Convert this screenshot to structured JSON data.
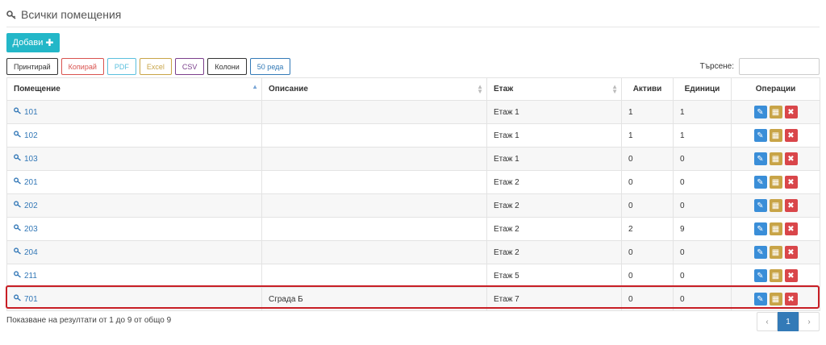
{
  "header": {
    "title": "Всички помещения",
    "icon": "key-icon"
  },
  "toolbar": {
    "add_label": "Добави",
    "add_icon": "plus-icon"
  },
  "export_buttons": [
    {
      "label": "Принтирай",
      "color": "#333333"
    },
    {
      "label": "Копирай",
      "color": "#d9534f"
    },
    {
      "label": "PDF",
      "color": "#5bc0de"
    },
    {
      "label": "Excel",
      "color": "#c8a447"
    },
    {
      "label": "CSV",
      "color": "#7b3f8c"
    },
    {
      "label": "Колони",
      "color": "#333333"
    },
    {
      "label": "50 реда",
      "color": "#337ab7"
    }
  ],
  "search": {
    "label": "Търсене:",
    "value": ""
  },
  "table": {
    "columns": [
      "Помещение",
      "Описание",
      "Етаж",
      "Активи",
      "Единици",
      "Операции"
    ],
    "rows": [
      {
        "room": "101",
        "description": "",
        "floor": "Етаж 1",
        "assets": "1",
        "units": "1"
      },
      {
        "room": "102",
        "description": "",
        "floor": "Етаж 1",
        "assets": "1",
        "units": "1"
      },
      {
        "room": "103",
        "description": "",
        "floor": "Етаж 1",
        "assets": "0",
        "units": "0"
      },
      {
        "room": "201",
        "description": "",
        "floor": "Етаж 2",
        "assets": "0",
        "units": "0"
      },
      {
        "room": "202",
        "description": "",
        "floor": "Етаж 2",
        "assets": "0",
        "units": "0"
      },
      {
        "room": "203",
        "description": "",
        "floor": "Етаж 2",
        "assets": "2",
        "units": "9"
      },
      {
        "room": "204",
        "description": "",
        "floor": "Етаж 2",
        "assets": "0",
        "units": "0"
      },
      {
        "room": "211",
        "description": "",
        "floor": "Етаж 5",
        "assets": "0",
        "units": "0"
      },
      {
        "room": "701",
        "description": "Сграда Б",
        "floor": "Етаж 7",
        "assets": "0",
        "units": "0"
      }
    ],
    "highlighted_row_index": 8
  },
  "footer": {
    "info": "Показване на резултати от 1 до 9 от общо 9"
  },
  "pager": {
    "prev": "‹",
    "current": "1",
    "next": "›"
  },
  "colors": {
    "accent": "#23b7c8",
    "edit": "#3a8ed8",
    "qr": "#c8a447",
    "delete": "#d9464a",
    "highlight": "#c81e25"
  }
}
